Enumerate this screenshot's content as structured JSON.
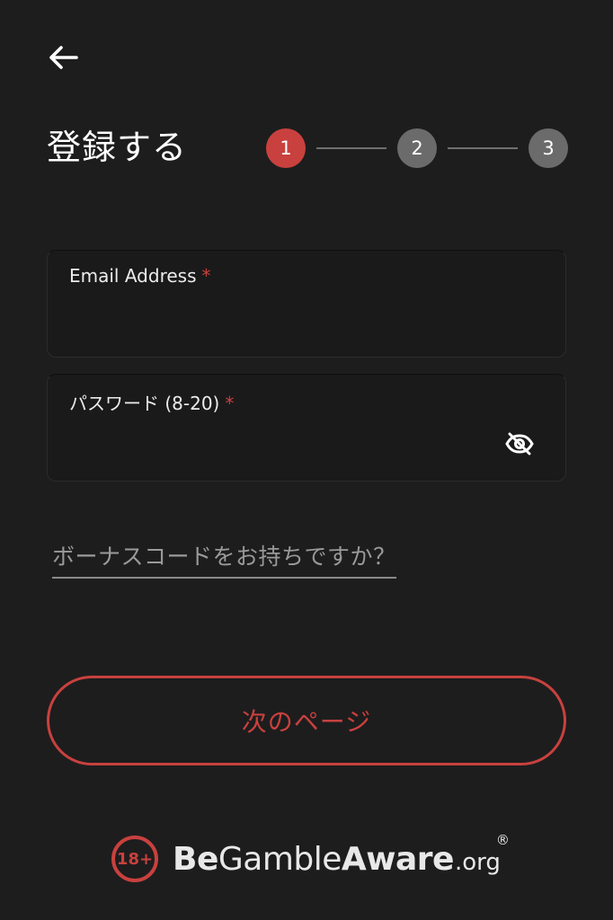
{
  "header": {
    "back_icon": "arrow-left-icon",
    "title": "登録する"
  },
  "stepper": {
    "current_step": 1,
    "steps": [
      "1",
      "2",
      "3"
    ],
    "active_color": "#c8413e",
    "inactive_color": "#6b6b6b"
  },
  "form": {
    "email": {
      "label": "Email Address",
      "required_mark": "*",
      "value": ""
    },
    "password": {
      "label": "パスワード (8-20)",
      "required_mark": "*",
      "value": "",
      "toggle_icon": "eye-off-icon"
    },
    "bonus_link": "ボーナスコードをお持ちですか？"
  },
  "actions": {
    "next_label": "次のページ"
  },
  "footer": {
    "age_badge": "18+",
    "brand_be": "Be",
    "brand_gamble": "Gamble",
    "brand_aware": "Aware",
    "brand_org": ".org",
    "registered_mark": "®"
  },
  "colors": {
    "background": "#1d1d1e",
    "accent": "#c8413e"
  }
}
